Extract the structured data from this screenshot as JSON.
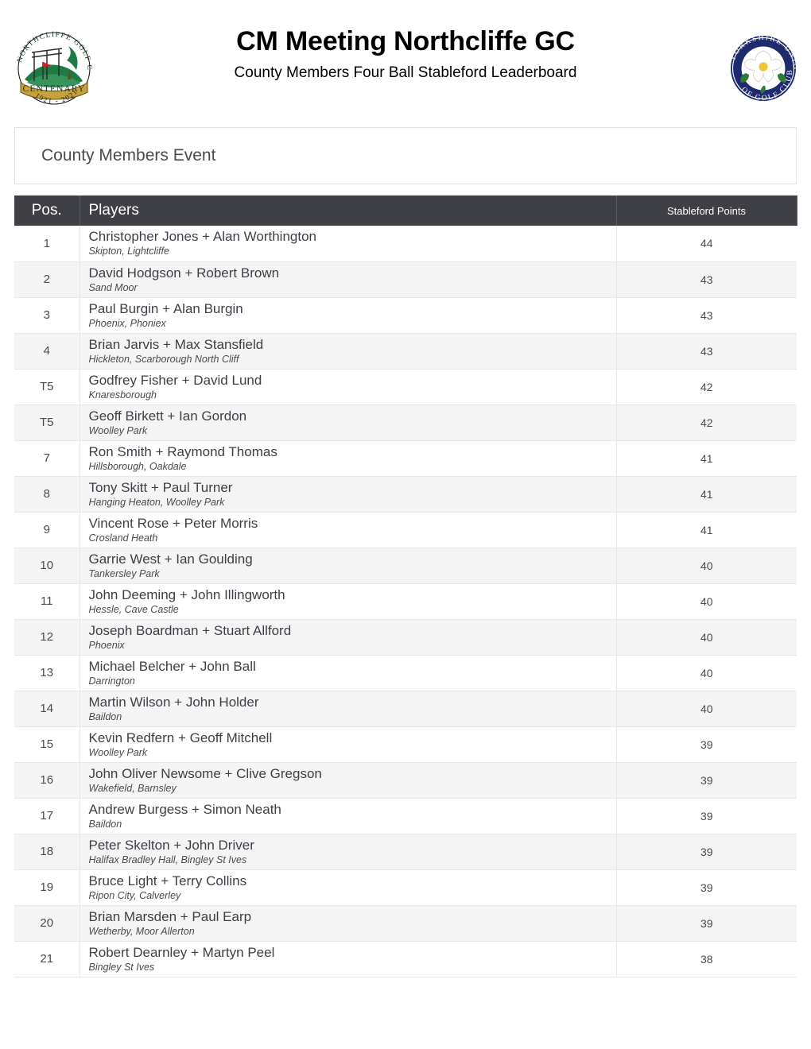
{
  "header": {
    "title": "CM Meeting Northcliffe GC",
    "subtitle": "County Members Four Ball Stableford Leaderboard",
    "left_logo": {
      "name": "northcliffe-golf-club-centenary-logo",
      "ring_text": "NORTHCLIFFE GOLF CLUB",
      "banner_text": "CENTENARY",
      "years_text": "1921 - 2021"
    },
    "right_logo": {
      "name": "yorkshire-union-of-golf-clubs-logo",
      "ring_text_top": "YORKSHIRE UNION",
      "ring_text_bottom": "OF GOLF CLUBS",
      "emblem": "white-rose"
    }
  },
  "event_panel": {
    "title": "County Members Event"
  },
  "table": {
    "columns": [
      "Pos.",
      "Players",
      "Stableford Points"
    ],
    "rows": [
      {
        "pos": "1",
        "players": "Christopher Jones + Alan Worthington",
        "clubs": "Skipton, Lightcliffe",
        "points": "44"
      },
      {
        "pos": "2",
        "players": "David Hodgson + Robert Brown",
        "clubs": "Sand Moor",
        "points": "43"
      },
      {
        "pos": "3",
        "players": "Paul Burgin + Alan Burgin",
        "clubs": "Phoenix, Phoniex",
        "points": "43"
      },
      {
        "pos": "4",
        "players": "Brian Jarvis + Max Stansfield",
        "clubs": "Hickleton, Scarborough North Cliff",
        "points": "43"
      },
      {
        "pos": "T5",
        "players": "Godfrey Fisher + David Lund",
        "clubs": "Knaresborough",
        "points": "42"
      },
      {
        "pos": "T5",
        "players": "Geoff Birkett + Ian Gordon",
        "clubs": "Woolley Park",
        "points": "42"
      },
      {
        "pos": "7",
        "players": "Ron Smith + Raymond Thomas",
        "clubs": "Hillsborough, Oakdale",
        "points": "41"
      },
      {
        "pos": "8",
        "players": "Tony Skitt + Paul Turner",
        "clubs": "Hanging Heaton, Woolley Park",
        "points": "41"
      },
      {
        "pos": "9",
        "players": "Vincent Rose + Peter Morris",
        "clubs": "Crosland Heath",
        "points": "41"
      },
      {
        "pos": "10",
        "players": "Garrie West + Ian Goulding",
        "clubs": "Tankersley Park",
        "points": "40"
      },
      {
        "pos": "11",
        "players": "John Deeming + John Illingworth",
        "clubs": "Hessle, Cave Castle",
        "points": "40"
      },
      {
        "pos": "12",
        "players": "Joseph Boardman + Stuart Allford",
        "clubs": "Phoenix",
        "points": "40"
      },
      {
        "pos": "13",
        "players": "Michael Belcher + John Ball",
        "clubs": "Darrington",
        "points": "40"
      },
      {
        "pos": "14",
        "players": "Martin Wilson + John Holder",
        "clubs": "Baildon",
        "points": "40"
      },
      {
        "pos": "15",
        "players": "Kevin Redfern + Geoff Mitchell",
        "clubs": "Woolley Park",
        "points": "39"
      },
      {
        "pos": "16",
        "players": "John Oliver Newsome + Clive Gregson",
        "clubs": "Wakefield, Barnsley",
        "points": "39"
      },
      {
        "pos": "17",
        "players": "Andrew Burgess + Simon Neath",
        "clubs": "Baildon",
        "points": "39"
      },
      {
        "pos": "18",
        "players": "Peter Skelton + John Driver",
        "clubs": "Halifax Bradley Hall, Bingley St Ives",
        "points": "39"
      },
      {
        "pos": "19",
        "players": "Bruce Light + Terry Collins",
        "clubs": "Ripon City, Calverley",
        "points": "39"
      },
      {
        "pos": "20",
        "players": "Brian Marsden + Paul Earp",
        "clubs": "Wetherby, Moor Allerton",
        "points": "39"
      },
      {
        "pos": "21",
        "players": "Robert Dearnley + Martyn Peel",
        "clubs": "Bingley St Ives",
        "points": "38"
      }
    ]
  },
  "colors": {
    "header_bar": "#3f3f46",
    "row_alt": "#f4f4f5",
    "text": "#4a4a4f",
    "border": "#e8e8e8",
    "yorkshire_navy": "#1f2a6e",
    "northcliffe_green": "#0e6b3f",
    "centenary_gold": "#c8a13a"
  }
}
